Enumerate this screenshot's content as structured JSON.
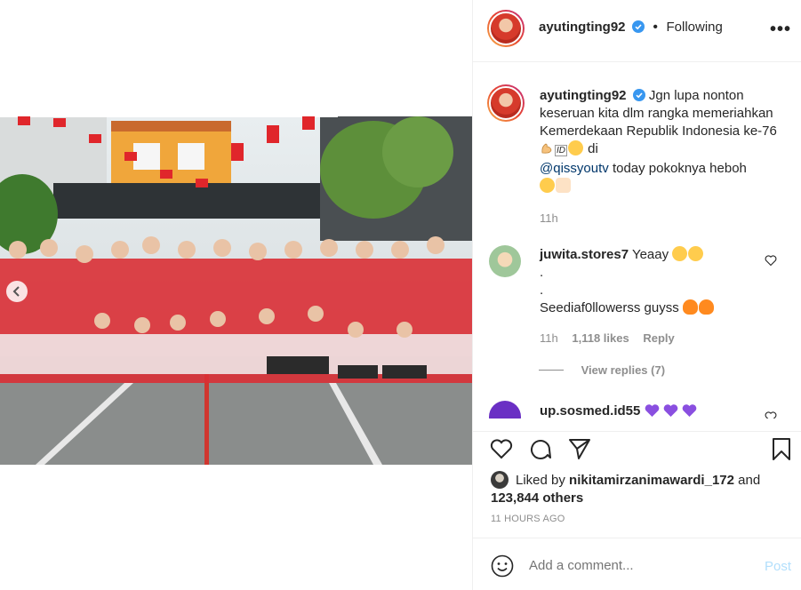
{
  "post": {
    "username": "ayutingting92",
    "dot": "•",
    "following_label": "Following",
    "more_label": "•••"
  },
  "caption": {
    "username": "ayutingting92",
    "text_1": "Jgn lupa nonton keseruan kita dlm rangka memeriahkan Kemerdekaan Republik Indonesia ke-76",
    "flag_badge": "ID",
    "text_2": "di",
    "mention": "@qissyoutv",
    "text_3": "today pokoknya heboh",
    "time": "11h"
  },
  "comments": [
    {
      "username": "juwita.stores7",
      "line1": "Yeaay",
      "line2": ".",
      "line3": ".",
      "line4": "Seediaf0llowerss guyss",
      "time": "11h",
      "likes": "1,118 likes",
      "reply_label": "Reply",
      "view_replies": "View replies (7)"
    },
    {
      "username": "up.sosmed.id55",
      "line1": ""
    }
  ],
  "likes": {
    "prefix": "Liked by",
    "user": "nikitamirzanimawardi_172",
    "conj": "and",
    "others": "123,844 others"
  },
  "timestamp": "11 HOURS AGO",
  "add_comment": {
    "placeholder": "Add a comment...",
    "post_label": "Post"
  },
  "icons": {
    "verified": "verified-badge-icon",
    "more": "more-options-icon",
    "like": "heart-icon",
    "comment": "comment-icon",
    "share": "share-icon",
    "save": "bookmark-icon",
    "emoji": "emoji-icon",
    "prev": "chevron-left-icon"
  },
  "colors": {
    "verified_blue": "#3897f0",
    "link_blue": "#00376b",
    "muted": "#8e8e8e",
    "post_disabled": "#b2dffc",
    "border": "#efefef"
  }
}
